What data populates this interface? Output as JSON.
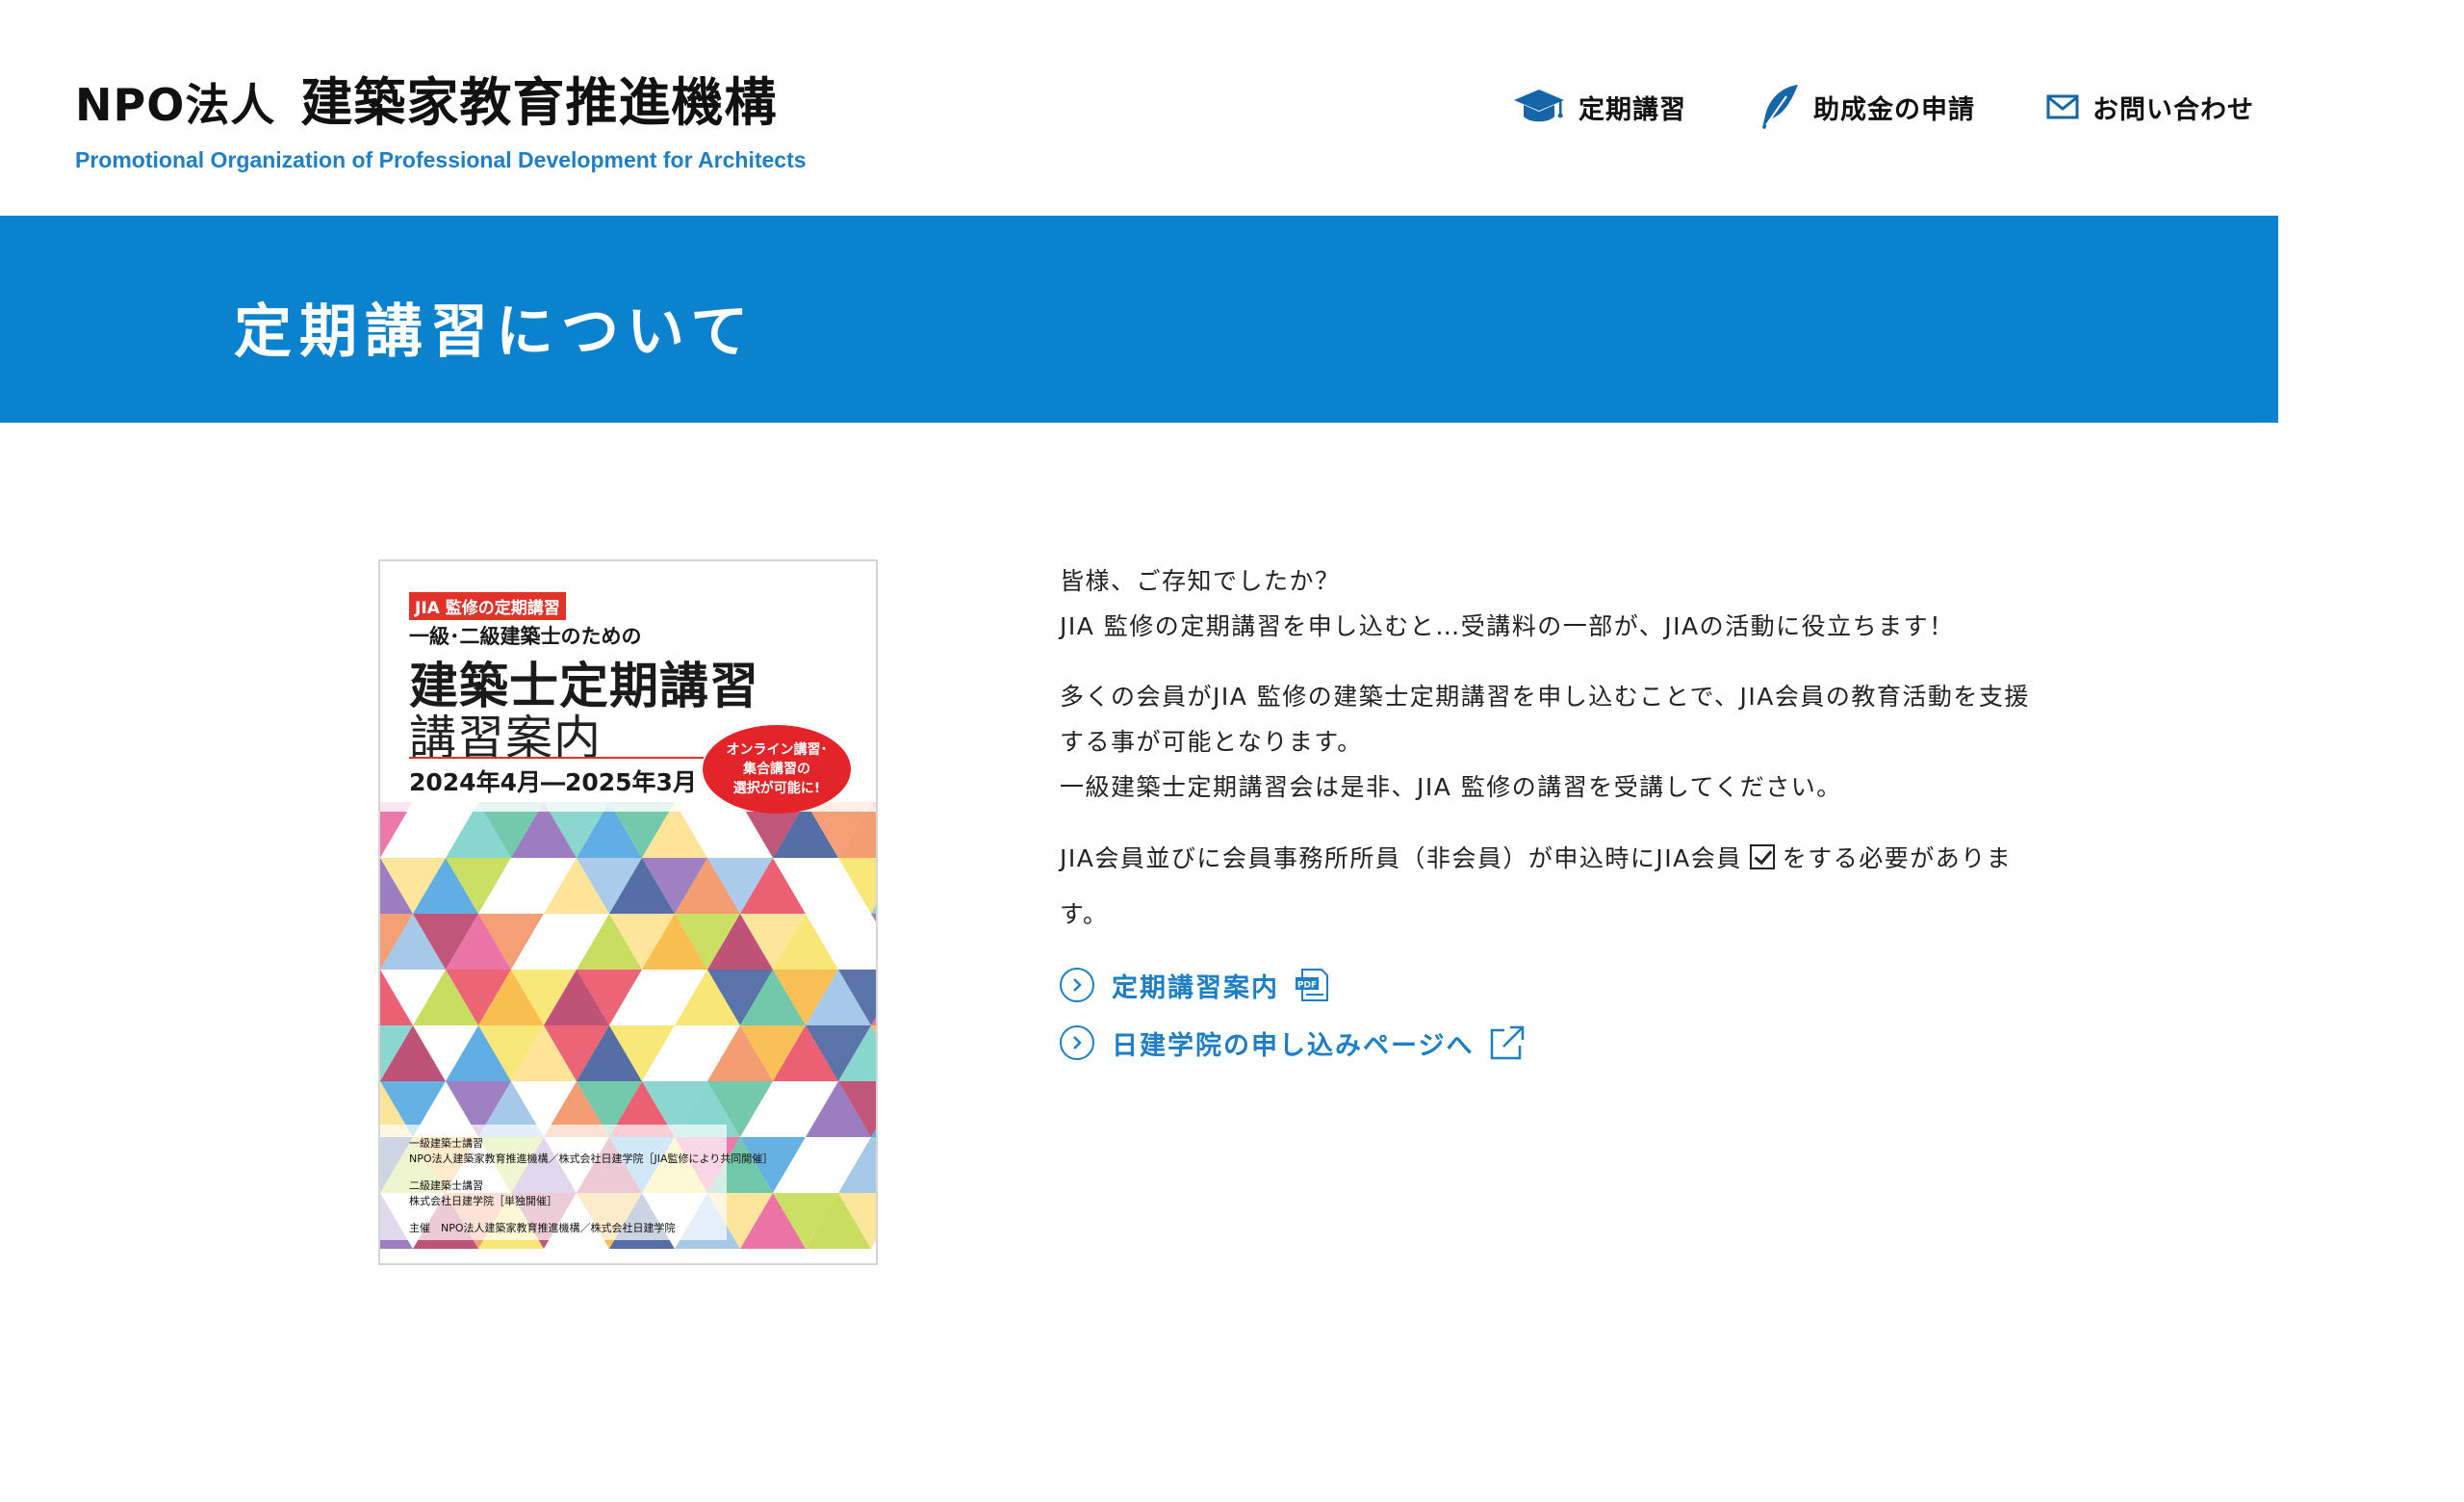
{
  "header": {
    "logo_npo": "NPO法人",
    "logo_name": "建築家教育推進機構",
    "logo_en": "Promotional Organization of Professional Development for Architects"
  },
  "nav": {
    "items": [
      {
        "label": "定期講習",
        "icon": "graduation-cap-icon"
      },
      {
        "label": "助成金の申請",
        "icon": "feather-pen-icon"
      },
      {
        "label": "お問い合わせ",
        "icon": "envelope-icon"
      }
    ]
  },
  "banner": {
    "title": "定期講習について"
  },
  "brochure": {
    "tag": "JIA 監修の定期講習",
    "subtitle": "一級･二級建築士のための",
    "title": "建築士定期講習",
    "title2": "講習案内",
    "date": "2024年4月―2025年3月",
    "badge_line1": "オンライン講習･",
    "badge_line2": "集合講習の",
    "badge_line3": "選択が可能に!",
    "foot1": "一級建築士講習",
    "foot2": "NPO法人建築家教育推進機構／株式会社日建学院［JIA監修により共同開催］",
    "foot3": "二級建築士講習",
    "foot4": "株式会社日建学院［単独開催］",
    "foot5": "主催　NPO法人建築家教育推進機構／株式会社日建学院"
  },
  "content": {
    "p1_line1": "皆様、ご存知でしたか？",
    "p1_line2": "JIA 監修の定期講習を申し込むと…受講料の一部が、JIAの活動に役立ちます！",
    "p2_line1": "多くの会員がJIA 監修の建築士定期講習を申し込むことで、JIA会員の教育活動を支援",
    "p2_line2": "する事が可能となります。",
    "p2_line3": "一級建築士定期講習会は是非、JIA 監修の講習を受講してください。",
    "p3_before": "JIA会員並びに会員事務所所員（非会員）が申込時にJIA会員",
    "p3_after": "をする必要がありま",
    "p3_line2": "す。"
  },
  "links": [
    {
      "label": "定期講習案内",
      "icon": "pdf-icon"
    },
    {
      "label": "日建学院の申し込みページへ",
      "icon": "external-link-icon"
    }
  ],
  "colors": {
    "banner": "#0a82cd",
    "accent": "#1e7fc6",
    "badge": "#e32428"
  }
}
